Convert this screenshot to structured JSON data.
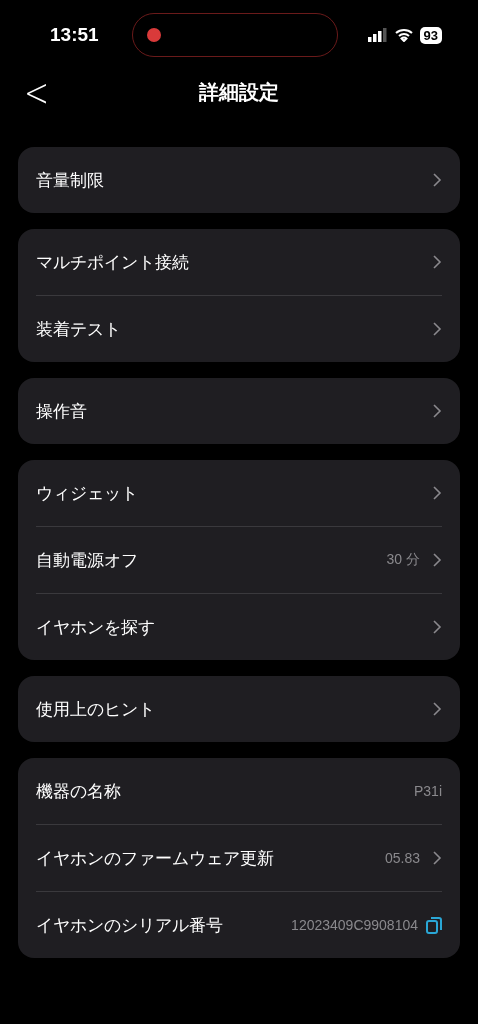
{
  "status_bar": {
    "time": "13:51",
    "battery": "93",
    "recording": true
  },
  "header": {
    "back": "<",
    "title": "詳細設定"
  },
  "groups": [
    {
      "rows": [
        {
          "label": "音量制限",
          "kind": "link"
        }
      ]
    },
    {
      "rows": [
        {
          "label": "マルチポイント接続",
          "kind": "link"
        },
        {
          "label": "装着テスト",
          "kind": "link"
        }
      ]
    },
    {
      "rows": [
        {
          "label": "操作音",
          "kind": "link"
        }
      ]
    },
    {
      "rows": [
        {
          "label": "ウィジェット",
          "kind": "link"
        },
        {
          "label": "自動電源オフ",
          "kind": "link",
          "value": "30 分"
        },
        {
          "label": "イヤホンを探す",
          "kind": "link"
        }
      ]
    },
    {
      "rows": [
        {
          "label": "使用上のヒント",
          "kind": "link"
        }
      ]
    },
    {
      "rows": [
        {
          "label": "機器の名称",
          "kind": "value",
          "value": "P31i"
        },
        {
          "label": "イヤホンのファームウェア更新",
          "kind": "link",
          "value": "05.83"
        },
        {
          "label": "イヤホンのシリアル番号",
          "kind": "copy",
          "value": "12023409C9908104"
        }
      ]
    }
  ]
}
